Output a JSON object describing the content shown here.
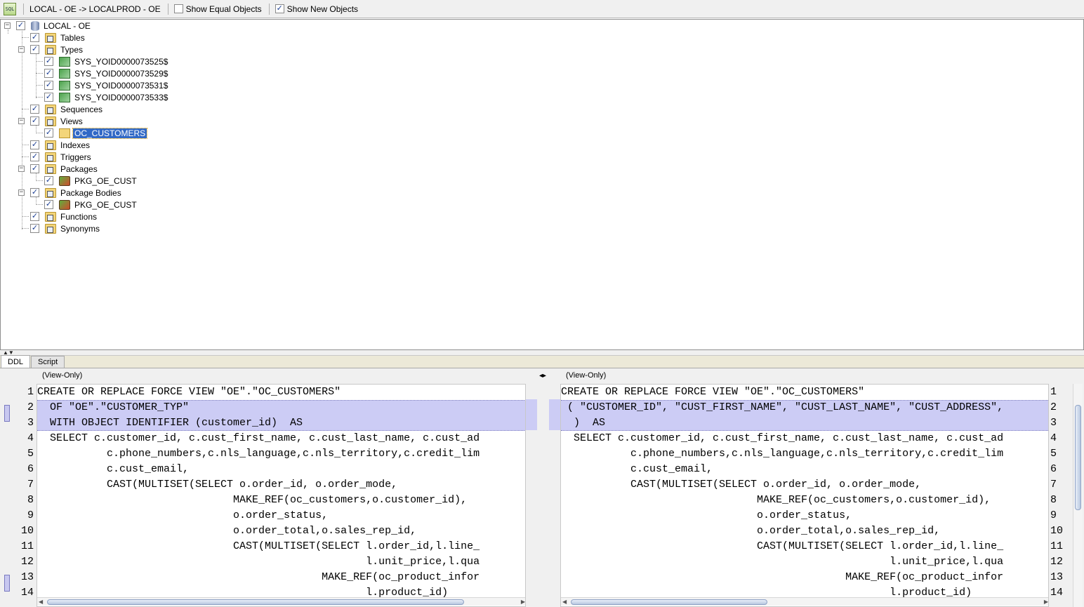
{
  "toolbar": {
    "icon": "sql-icon",
    "connection_label": "LOCAL - OE -> LOCALPROD - OE",
    "show_equal_label": "Show Equal Objects",
    "show_equal_checked": false,
    "show_new_label": "Show New Objects",
    "show_new_checked": true
  },
  "tree": {
    "root": "LOCAL - OE",
    "tables": "Tables",
    "types": "Types",
    "type_items": [
      "SYS_YOID0000073525$",
      "SYS_YOID0000073529$",
      "SYS_YOID0000073531$",
      "SYS_YOID0000073533$"
    ],
    "sequences": "Sequences",
    "views": "Views",
    "view_items": [
      "OC_CUSTOMERS"
    ],
    "indexes": "Indexes",
    "triggers": "Triggers",
    "packages": "Packages",
    "package_items": [
      "PKG_OE_CUST"
    ],
    "package_bodies": "Package Bodies",
    "package_body_items": [
      "PKG_OE_CUST"
    ],
    "functions": "Functions",
    "synonyms": "Synonyms"
  },
  "tabs": {
    "ddl": "DDL",
    "script": "Script"
  },
  "diff": {
    "left_header": "(View-Only)",
    "right_header": "(View-Only)",
    "swap_icon": "swap-arrows-icon",
    "swap_glyph": "◂▸",
    "left_lines": [
      "CREATE OR REPLACE FORCE VIEW \"OE\".\"OC_CUSTOMERS\"",
      "  OF \"OE\".\"CUSTOMER_TYP\"",
      "  WITH OBJECT IDENTIFIER (customer_id)  AS",
      "  SELECT c.customer_id, c.cust_first_name, c.cust_last_name, c.cust_ad",
      "           c.phone_numbers,c.nls_language,c.nls_territory,c.credit_lim",
      "           c.cust_email,",
      "           CAST(MULTISET(SELECT o.order_id, o.order_mode,",
      "                               MAKE_REF(oc_customers,o.customer_id),",
      "                               o.order_status,",
      "                               o.order_total,o.sales_rep_id,",
      "                               CAST(MULTISET(SELECT l.order_id,l.line_",
      "                                                    l.unit_price,l.qua",
      "                                             MAKE_REF(oc_product_infor",
      "                                                    l.product_id)"
    ],
    "right_lines": [
      "CREATE OR REPLACE FORCE VIEW \"OE\".\"OC_CUSTOMERS\"",
      " ( \"CUSTOMER_ID\", \"CUST_FIRST_NAME\", \"CUST_LAST_NAME\", \"CUST_ADDRESS\",",
      "  )  AS",
      "  SELECT c.customer_id, c.cust_first_name, c.cust_last_name, c.cust_ad",
      "           c.phone_numbers,c.nls_language,c.nls_territory,c.credit_lim",
      "           c.cust_email,",
      "           CAST(MULTISET(SELECT o.order_id, o.order_mode,",
      "                               MAKE_REF(oc_customers,o.customer_id),",
      "                               o.order_status,",
      "                               o.order_total,o.sales_rep_id,",
      "                               CAST(MULTISET(SELECT l.order_id,l.line_",
      "                                                    l.unit_price,l.qua",
      "                                             MAKE_REF(oc_product_infor",
      "                                                    l.product_id)"
    ],
    "line_numbers": [
      "1",
      "2",
      "3",
      "4",
      "5",
      "6",
      "7",
      "8",
      "9",
      "10",
      "11",
      "12",
      "13",
      "14"
    ]
  }
}
